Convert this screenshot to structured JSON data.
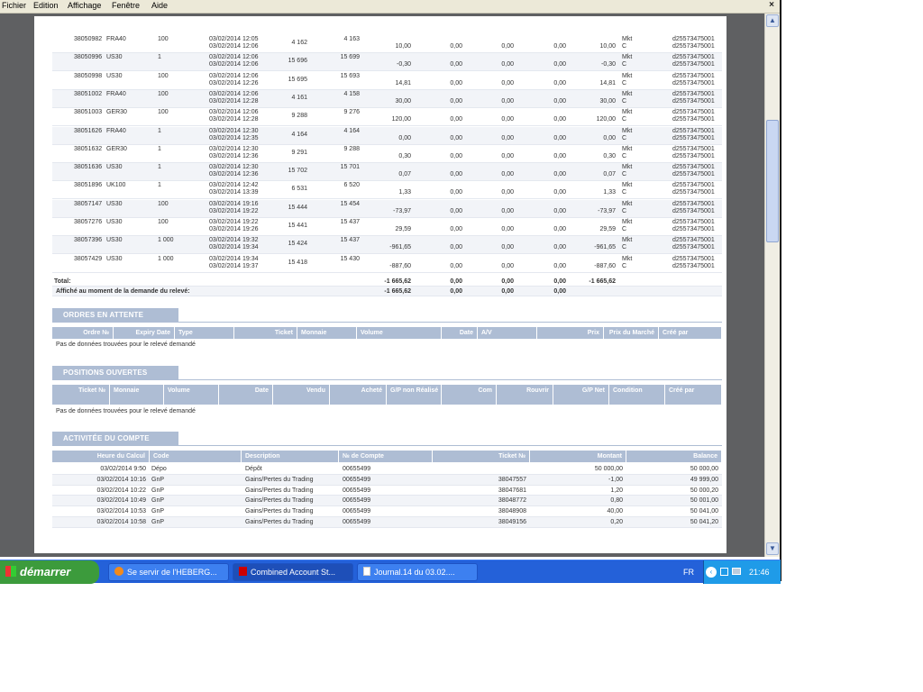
{
  "menu": {
    "items": [
      "Fichier",
      "Edition",
      "Affichage",
      "Fenêtre",
      "Aide"
    ],
    "close": "×"
  },
  "trades": [
    {
      "ticket": "38050982",
      "sym": "FRA40",
      "vol": "100",
      "t1": "03/02/2014 12:05",
      "t2": "03/02/2014 12:06",
      "p1": "4 162",
      "p2": "4 163",
      "pl": "10,00",
      "c1": "0,00",
      "c2": "0,00",
      "c3": "0,00",
      "net": "10,00",
      "com": "Mkt",
      "com2": "C",
      "acc": "d25573475001",
      "acc2": "d25573475001"
    },
    {
      "ticket": "38050996",
      "sym": "US30",
      "vol": "1",
      "t1": "03/02/2014 12:06",
      "t2": "03/02/2014 12:06",
      "p1": "15 696",
      "p2": "15 699",
      "pl": "-0,30",
      "c1": "0,00",
      "c2": "0,00",
      "c3": "0,00",
      "net": "-0,30",
      "com": "Mkt",
      "com2": "C",
      "acc": "d25573475001",
      "acc2": "d25573475001"
    },
    {
      "ticket": "38050998",
      "sym": "US30",
      "vol": "100",
      "t1": "03/02/2014 12:06",
      "t2": "03/02/2014 12:26",
      "p1": "15 695",
      "p2": "15 693",
      "pl": "14,81",
      "c1": "0,00",
      "c2": "0,00",
      "c3": "0,00",
      "net": "14,81",
      "com": "Mkt",
      "com2": "C",
      "acc": "d25573475001",
      "acc2": "d25573475001"
    },
    {
      "ticket": "38051002",
      "sym": "FRA40",
      "vol": "100",
      "t1": "03/02/2014 12:06",
      "t2": "03/02/2014 12:28",
      "p1": "4 161",
      "p2": "4 158",
      "pl": "30,00",
      "c1": "0,00",
      "c2": "0,00",
      "c3": "0,00",
      "net": "30,00",
      "com": "Mkt",
      "com2": "C",
      "acc": "d25573475001",
      "acc2": "d25573475001"
    },
    {
      "ticket": "38051003",
      "sym": "GER30",
      "vol": "100",
      "t1": "03/02/2014 12:06",
      "t2": "03/02/2014 12:28",
      "p1": "9 288",
      "p2": "9 276",
      "pl": "120,00",
      "c1": "0,00",
      "c2": "0,00",
      "c3": "0,00",
      "net": "120,00",
      "com": "Mkt",
      "com2": "C",
      "acc": "d25573475001",
      "acc2": "d25573475001"
    },
    {
      "ticket": "38051626",
      "sym": "FRA40",
      "vol": "1",
      "t1": "03/02/2014 12:30",
      "t2": "03/02/2014 12:35",
      "p1": "4 164",
      "p2": "4 164",
      "pl": "0,00",
      "c1": "0,00",
      "c2": "0,00",
      "c3": "0,00",
      "net": "0,00",
      "com": "Mkt",
      "com2": "C",
      "acc": "d25573475001",
      "acc2": "d25573475001"
    },
    {
      "ticket": "38051632",
      "sym": "GER30",
      "vol": "1",
      "t1": "03/02/2014 12:30",
      "t2": "03/02/2014 12:36",
      "p1": "9 291",
      "p2": "9 288",
      "pl": "0,30",
      "c1": "0,00",
      "c2": "0,00",
      "c3": "0,00",
      "net": "0,30",
      "com": "Mkt",
      "com2": "C",
      "acc": "d25573475001",
      "acc2": "d25573475001"
    },
    {
      "ticket": "38051636",
      "sym": "US30",
      "vol": "1",
      "t1": "03/02/2014 12:30",
      "t2": "03/02/2014 12:36",
      "p1": "15 702",
      "p2": "15 701",
      "pl": "0,07",
      "c1": "0,00",
      "c2": "0,00",
      "c3": "0,00",
      "net": "0,07",
      "com": "Mkt",
      "com2": "C",
      "acc": "d25573475001",
      "acc2": "d25573475001"
    },
    {
      "ticket": "38051896",
      "sym": "UK100",
      "vol": "1",
      "t1": "03/02/2014 12:42",
      "t2": "03/02/2014 13:39",
      "p1": "6 531",
      "p2": "6 520",
      "pl": "1,33",
      "c1": "0,00",
      "c2": "0,00",
      "c3": "0,00",
      "net": "1,33",
      "com": "Mkt",
      "com2": "C",
      "acc": "d25573475001",
      "acc2": "d25573475001"
    },
    {
      "ticket": "38057147",
      "sym": "US30",
      "vol": "100",
      "t1": "03/02/2014 19:16",
      "t2": "03/02/2014 19:22",
      "p1": "15 444",
      "p2": "15 454",
      "pl": "-73,97",
      "c1": "0,00",
      "c2": "0,00",
      "c3": "0,00",
      "net": "-73,97",
      "com": "Mkt",
      "com2": "C",
      "acc": "d25573475001",
      "acc2": "d25573475001"
    },
    {
      "ticket": "38057276",
      "sym": "US30",
      "vol": "100",
      "t1": "03/02/2014 19:22",
      "t2": "03/02/2014 19:26",
      "p1": "15 441",
      "p2": "15 437",
      "pl": "29,59",
      "c1": "0,00",
      "c2": "0,00",
      "c3": "0,00",
      "net": "29,59",
      "com": "Mkt",
      "com2": "C",
      "acc": "d25573475001",
      "acc2": "d25573475001"
    },
    {
      "ticket": "38057396",
      "sym": "US30",
      "vol": "1 000",
      "t1": "03/02/2014 19:32",
      "t2": "03/02/2014 19:34",
      "p1": "15 424",
      "p2": "15 437",
      "pl": "-961,65",
      "c1": "0,00",
      "c2": "0,00",
      "c3": "0,00",
      "net": "-961,65",
      "com": "Mkt",
      "com2": "C",
      "acc": "d25573475001",
      "acc2": "d25573475001"
    },
    {
      "ticket": "38057429",
      "sym": "US30",
      "vol": "1 000",
      "t1": "03/02/2014 19:34",
      "t2": "03/02/2014 19:37",
      "p1": "15 418",
      "p2": "15 430",
      "pl": "-887,60",
      "c1": "0,00",
      "c2": "0,00",
      "c3": "0,00",
      "net": "-887,60",
      "com": "Mkt",
      "com2": "C",
      "acc": "d25573475001",
      "acc2": "d25573475001"
    }
  ],
  "totals": {
    "label": "Total:",
    "pl": "-1 665,62",
    "c1": "0,00",
    "c2": "0,00",
    "c3": "0,00",
    "net": "-1 665,62",
    "label2": "Affiché au moment de la demande du relevé:",
    "pl2": "-1 665,62",
    "d1": "0,00",
    "d2": "0,00",
    "d3": "0,00"
  },
  "pending": {
    "title": "ORDRES EN ATTENTE",
    "headers": [
      "Ordre №",
      "Expiry Date",
      "Type",
      "Ticket",
      "Monnaie",
      "Volume",
      "Date",
      "A/V",
      "Prix",
      "Prix du Marché",
      "Créé par"
    ],
    "empty": "Pas de données trouvées pour le relevé demandé"
  },
  "open": {
    "title": "POSITIONS OUVERTES",
    "headers": [
      "Ticket №",
      "Monnaie",
      "Volume",
      "Date",
      "Vendu",
      "Acheté",
      "G/P non Réalisé",
      "Com",
      "Rouvrir",
      "G/P Net",
      "Condition",
      "Créé par"
    ],
    "empty": "Pas de données trouvées pour le relevé demandé"
  },
  "activity": {
    "title": "ACTIVITÉE DU COMPTE",
    "headers": [
      "Heure du Calcul",
      "Code",
      "Description",
      "№ de Compte",
      "Ticket №",
      "Montant",
      "Balance"
    ],
    "rows": [
      {
        "time": "03/02/2014 9:50",
        "code": "Dépo",
        "desc": "Dépôt",
        "acct": "00655499",
        "ticket": "",
        "amt": "50 000,00",
        "bal": "50 000,00"
      },
      {
        "time": "03/02/2014 10:16",
        "code": "GnP",
        "desc": "Gains/Pertes du Trading",
        "acct": "00655499",
        "ticket": "38047557",
        "amt": "-1,00",
        "bal": "49 999,00"
      },
      {
        "time": "03/02/2014 10:22",
        "code": "GnP",
        "desc": "Gains/Pertes du Trading",
        "acct": "00655499",
        "ticket": "38047681",
        "amt": "1,20",
        "bal": "50 000,20"
      },
      {
        "time": "03/02/2014 10:49",
        "code": "GnP",
        "desc": "Gains/Pertes du Trading",
        "acct": "00655499",
        "ticket": "38048772",
        "amt": "0,80",
        "bal": "50 001,00"
      },
      {
        "time": "03/02/2014 10:53",
        "code": "GnP",
        "desc": "Gains/Pertes du Trading",
        "acct": "00655499",
        "ticket": "38048908",
        "amt": "40,00",
        "bal": "50 041,00"
      },
      {
        "time": "03/02/2014 10:58",
        "code": "GnP",
        "desc": "Gains/Pertes du Trading",
        "acct": "00655499",
        "ticket": "38049156",
        "amt": "0,20",
        "bal": "50 041,20"
      }
    ]
  },
  "taskbar": {
    "start": "démarrer",
    "tasks": [
      "Se servir de l'HEBERG...",
      "Combined Account St...",
      "Journal.14 du 03.02...."
    ],
    "lang": "FR",
    "clock": "21:46"
  },
  "colors": {
    "header": "#aebdd4",
    "taskbar": "#2461d9",
    "start": "#3c9b3c"
  }
}
